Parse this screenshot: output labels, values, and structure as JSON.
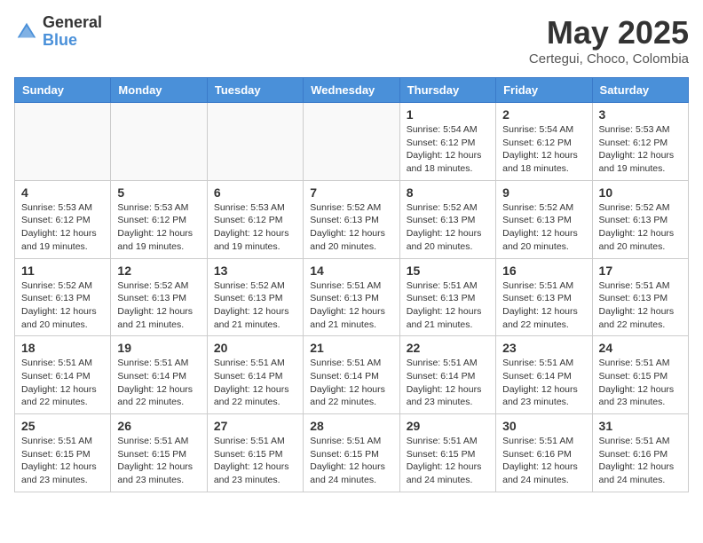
{
  "logo": {
    "general": "General",
    "blue": "Blue"
  },
  "title": {
    "month_year": "May 2025",
    "location": "Certegui, Choco, Colombia"
  },
  "weekdays": [
    "Sunday",
    "Monday",
    "Tuesday",
    "Wednesday",
    "Thursday",
    "Friday",
    "Saturday"
  ],
  "weeks": [
    [
      {
        "day": "",
        "info": ""
      },
      {
        "day": "",
        "info": ""
      },
      {
        "day": "",
        "info": ""
      },
      {
        "day": "",
        "info": ""
      },
      {
        "day": "1",
        "info": "Sunrise: 5:54 AM\nSunset: 6:12 PM\nDaylight: 12 hours\nand 18 minutes."
      },
      {
        "day": "2",
        "info": "Sunrise: 5:54 AM\nSunset: 6:12 PM\nDaylight: 12 hours\nand 18 minutes."
      },
      {
        "day": "3",
        "info": "Sunrise: 5:53 AM\nSunset: 6:12 PM\nDaylight: 12 hours\nand 19 minutes."
      }
    ],
    [
      {
        "day": "4",
        "info": "Sunrise: 5:53 AM\nSunset: 6:12 PM\nDaylight: 12 hours\nand 19 minutes."
      },
      {
        "day": "5",
        "info": "Sunrise: 5:53 AM\nSunset: 6:12 PM\nDaylight: 12 hours\nand 19 minutes."
      },
      {
        "day": "6",
        "info": "Sunrise: 5:53 AM\nSunset: 6:12 PM\nDaylight: 12 hours\nand 19 minutes."
      },
      {
        "day": "7",
        "info": "Sunrise: 5:52 AM\nSunset: 6:13 PM\nDaylight: 12 hours\nand 20 minutes."
      },
      {
        "day": "8",
        "info": "Sunrise: 5:52 AM\nSunset: 6:13 PM\nDaylight: 12 hours\nand 20 minutes."
      },
      {
        "day": "9",
        "info": "Sunrise: 5:52 AM\nSunset: 6:13 PM\nDaylight: 12 hours\nand 20 minutes."
      },
      {
        "day": "10",
        "info": "Sunrise: 5:52 AM\nSunset: 6:13 PM\nDaylight: 12 hours\nand 20 minutes."
      }
    ],
    [
      {
        "day": "11",
        "info": "Sunrise: 5:52 AM\nSunset: 6:13 PM\nDaylight: 12 hours\nand 20 minutes."
      },
      {
        "day": "12",
        "info": "Sunrise: 5:52 AM\nSunset: 6:13 PM\nDaylight: 12 hours\nand 21 minutes."
      },
      {
        "day": "13",
        "info": "Sunrise: 5:52 AM\nSunset: 6:13 PM\nDaylight: 12 hours\nand 21 minutes."
      },
      {
        "day": "14",
        "info": "Sunrise: 5:51 AM\nSunset: 6:13 PM\nDaylight: 12 hours\nand 21 minutes."
      },
      {
        "day": "15",
        "info": "Sunrise: 5:51 AM\nSunset: 6:13 PM\nDaylight: 12 hours\nand 21 minutes."
      },
      {
        "day": "16",
        "info": "Sunrise: 5:51 AM\nSunset: 6:13 PM\nDaylight: 12 hours\nand 22 minutes."
      },
      {
        "day": "17",
        "info": "Sunrise: 5:51 AM\nSunset: 6:13 PM\nDaylight: 12 hours\nand 22 minutes."
      }
    ],
    [
      {
        "day": "18",
        "info": "Sunrise: 5:51 AM\nSunset: 6:14 PM\nDaylight: 12 hours\nand 22 minutes."
      },
      {
        "day": "19",
        "info": "Sunrise: 5:51 AM\nSunset: 6:14 PM\nDaylight: 12 hours\nand 22 minutes."
      },
      {
        "day": "20",
        "info": "Sunrise: 5:51 AM\nSunset: 6:14 PM\nDaylight: 12 hours\nand 22 minutes."
      },
      {
        "day": "21",
        "info": "Sunrise: 5:51 AM\nSunset: 6:14 PM\nDaylight: 12 hours\nand 22 minutes."
      },
      {
        "day": "22",
        "info": "Sunrise: 5:51 AM\nSunset: 6:14 PM\nDaylight: 12 hours\nand 23 minutes."
      },
      {
        "day": "23",
        "info": "Sunrise: 5:51 AM\nSunset: 6:14 PM\nDaylight: 12 hours\nand 23 minutes."
      },
      {
        "day": "24",
        "info": "Sunrise: 5:51 AM\nSunset: 6:15 PM\nDaylight: 12 hours\nand 23 minutes."
      }
    ],
    [
      {
        "day": "25",
        "info": "Sunrise: 5:51 AM\nSunset: 6:15 PM\nDaylight: 12 hours\nand 23 minutes."
      },
      {
        "day": "26",
        "info": "Sunrise: 5:51 AM\nSunset: 6:15 PM\nDaylight: 12 hours\nand 23 minutes."
      },
      {
        "day": "27",
        "info": "Sunrise: 5:51 AM\nSunset: 6:15 PM\nDaylight: 12 hours\nand 23 minutes."
      },
      {
        "day": "28",
        "info": "Sunrise: 5:51 AM\nSunset: 6:15 PM\nDaylight: 12 hours\nand 24 minutes."
      },
      {
        "day": "29",
        "info": "Sunrise: 5:51 AM\nSunset: 6:15 PM\nDaylight: 12 hours\nand 24 minutes."
      },
      {
        "day": "30",
        "info": "Sunrise: 5:51 AM\nSunset: 6:16 PM\nDaylight: 12 hours\nand 24 minutes."
      },
      {
        "day": "31",
        "info": "Sunrise: 5:51 AM\nSunset: 6:16 PM\nDaylight: 12 hours\nand 24 minutes."
      }
    ]
  ]
}
